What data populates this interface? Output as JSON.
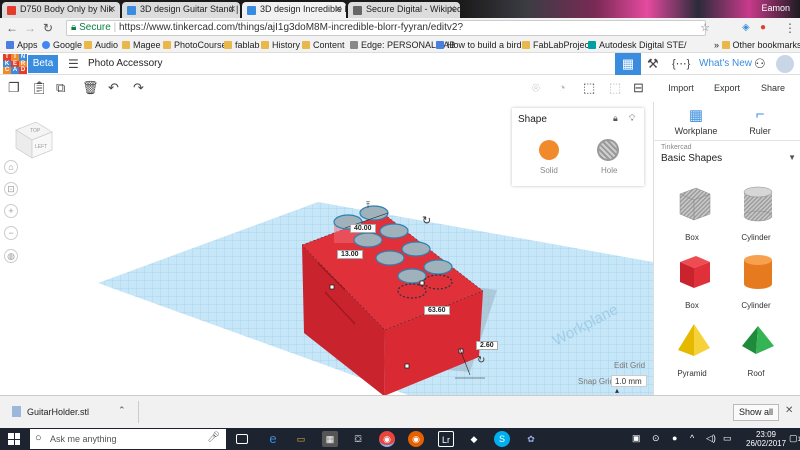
{
  "browser": {
    "tabs": [
      {
        "title": "D750 Body Only by Nik",
        "favicon_color": "#e33c2c"
      },
      {
        "title": "3D design Guitar Stand |",
        "favicon_color": "#3a8dde"
      },
      {
        "title": "3D design Incredible Blo",
        "favicon_color": "#3a8dde"
      },
      {
        "title": "Secure Digital - Wikipedi",
        "favicon_color": "#666666"
      }
    ],
    "user": "Eamon",
    "secure_label": "Secure",
    "url": "https://www.tinkercad.com/things/ajI1g3doM8M-incredible-blorr-fyyran/editv2?",
    "bookmarks": [
      "Apps",
      "Google",
      "Audio",
      "Magee",
      "PhotoCourse",
      "fablab",
      "History",
      "Content",
      "Edge: PERSONAL FAB",
      "How to build a bird b",
      "FabLabProjects",
      "Autodesk Digital STE/"
    ],
    "other_bookmarks": "Other bookmarks"
  },
  "tinkercad": {
    "logo_letters": [
      "T",
      "I",
      "N",
      "K",
      "E",
      "R",
      "C",
      "A",
      "D"
    ],
    "beta": "Beta",
    "design_title": "Photo Accessory",
    "whats_new": "What's New",
    "actions": {
      "import": "Import",
      "export": "Export",
      "share": "Share"
    }
  },
  "viewcube": {
    "top": "TOP",
    "left": "LEFT"
  },
  "inspector": {
    "title": "Shape",
    "solid": "Solid",
    "hole": "Hole",
    "solid_color": "#f08a2c"
  },
  "dimensions": {
    "width": "40.00",
    "depth": "13.00",
    "length": "63.60",
    "height": "2.60"
  },
  "grid": {
    "edit_grid": "Edit Grid",
    "snap_grid": "Snap Grid",
    "snap_value": "1.0 mm ▴",
    "workplane_text": "Workplane"
  },
  "library": {
    "workplane": "Workplane",
    "ruler": "Ruler",
    "category_small": "Tinkercad",
    "category": "Basic Shapes",
    "shapes": [
      {
        "name": "Box",
        "icon": "box-hole-icon"
      },
      {
        "name": "Cylinder",
        "icon": "cylinder-hole-icon"
      },
      {
        "name": "Box",
        "icon": "box-red-icon"
      },
      {
        "name": "Cylinder",
        "icon": "cylinder-orange-icon"
      },
      {
        "name": "Pyramid",
        "icon": "pyramid-icon"
      },
      {
        "name": "Roof",
        "icon": "roof-icon"
      }
    ]
  },
  "download": {
    "file": "GuitarHolder.stl",
    "show_all": "Show all"
  },
  "taskbar": {
    "search_placeholder": "Ask me anything",
    "time": "23:09",
    "date": "26/02/2017",
    "notif_count": "11"
  }
}
